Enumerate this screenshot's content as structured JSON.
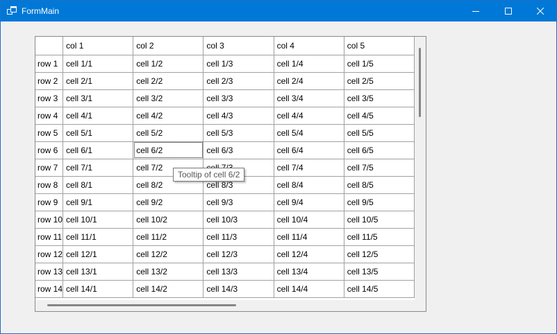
{
  "window": {
    "title": "FormMain",
    "titlebar_color": "#0078d7",
    "controls": [
      "minimize-icon",
      "maximize-icon",
      "close-icon"
    ]
  },
  "grid": {
    "columns": [
      "col 1",
      "col 2",
      "col 3",
      "col 4",
      "col 5"
    ],
    "rows": [
      {
        "header": "row 1",
        "cells": [
          "cell 1/1",
          "cell 1/2",
          "cell 1/3",
          "cell 1/4",
          "cell 1/5"
        ]
      },
      {
        "header": "row 2",
        "cells": [
          "cell 2/1",
          "cell 2/2",
          "cell 2/3",
          "cell 2/4",
          "cell 2/5"
        ]
      },
      {
        "header": "row 3",
        "cells": [
          "cell 3/1",
          "cell 3/2",
          "cell 3/3",
          "cell 3/4",
          "cell 3/5"
        ]
      },
      {
        "header": "row 4",
        "cells": [
          "cell 4/1",
          "cell 4/2",
          "cell 4/3",
          "cell 4/4",
          "cell 4/5"
        ]
      },
      {
        "header": "row 5",
        "cells": [
          "cell 5/1",
          "cell 5/2",
          "cell 5/3",
          "cell 5/4",
          "cell 5/5"
        ]
      },
      {
        "header": "row 6",
        "cells": [
          "cell 6/1",
          "cell 6/2",
          "cell 6/3",
          "cell 6/4",
          "cell 6/5"
        ]
      },
      {
        "header": "row 7",
        "cells": [
          "cell 7/1",
          "cell 7/2",
          "cell 7/3",
          "cell 7/4",
          "cell 7/5"
        ]
      },
      {
        "header": "row 8",
        "cells": [
          "cell 8/1",
          "cell 8/2",
          "cell 8/3",
          "cell 8/4",
          "cell 8/5"
        ]
      },
      {
        "header": "row 9",
        "cells": [
          "cell 9/1",
          "cell 9/2",
          "cell 9/3",
          "cell 9/4",
          "cell 9/5"
        ]
      },
      {
        "header": "row 10",
        "cells": [
          "cell 10/1",
          "cell 10/2",
          "cell 10/3",
          "cell 10/4",
          "cell 10/5"
        ]
      },
      {
        "header": "row 11",
        "cells": [
          "cell 11/1",
          "cell 11/2",
          "cell 11/3",
          "cell 11/4",
          "cell 11/5"
        ]
      },
      {
        "header": "row 12",
        "cells": [
          "cell 12/1",
          "cell 12/2",
          "cell 12/3",
          "cell 12/4",
          "cell 12/5"
        ]
      },
      {
        "header": "row 13",
        "cells": [
          "cell 13/1",
          "cell 13/2",
          "cell 13/3",
          "cell 13/4",
          "cell 13/5"
        ]
      },
      {
        "header": "row 14",
        "cells": [
          "cell 14/1",
          "cell 14/2",
          "cell 14/3",
          "cell 14/4",
          "cell 14/5"
        ]
      }
    ],
    "focused_cell": "cell 6/2"
  },
  "tooltip": {
    "text": "Tooltip of cell 6/2"
  }
}
